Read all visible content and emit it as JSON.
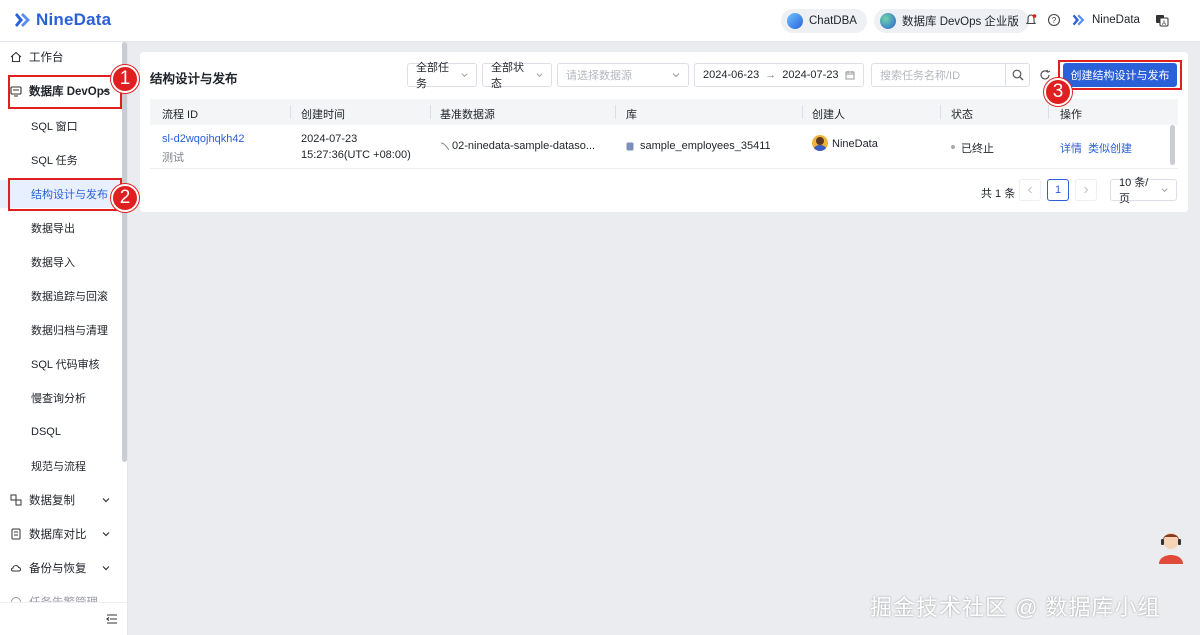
{
  "header": {
    "brand": "NineData",
    "chatdba": "ChatDBA",
    "edition": "数据库 DevOps 企业版",
    "user": "NineData"
  },
  "sidebar": {
    "workbench": "工作台",
    "devops": "数据库 DevOps",
    "sub_items": [
      "SQL 窗口",
      "SQL 任务",
      "结构设计与发布",
      "数据导出",
      "数据导入",
      "数据追踪与回滚",
      "数据归档与清理",
      "SQL 代码审核",
      "慢查询分析",
      "DSQL",
      "规范与流程"
    ],
    "groups": [
      "数据复制",
      "数据库对比",
      "备份与恢复",
      "任务告警管理"
    ]
  },
  "main": {
    "title": "结构设计与发布",
    "filter_task": "全部任务",
    "filter_status": "全部状态",
    "datasource_placeholder": "请选择数据源",
    "date_start": "2024-06-23",
    "date_arrow": "→",
    "date_end": "2024-07-23",
    "search_placeholder": "搜索任务名称/ID",
    "create_button": "创建结构设计与发布",
    "columns": [
      "流程 ID",
      "创建时间",
      "基准数据源",
      "库",
      "创建人",
      "状态",
      "操作"
    ],
    "row": {
      "id": "sl-d2wqojhqkh42",
      "note": "测试",
      "created_date": "2024-07-23",
      "created_time": "15:27:36(UTC +08:00)",
      "datasource": "02-ninedata-sample-dataso...",
      "database": "sample_employees_35411",
      "creator": "NineData",
      "status": "已终止",
      "action_detail": "详情",
      "action_clone": "类似创建"
    },
    "pagination": {
      "total": "共 1 条",
      "current_page": "1",
      "page_size": "10 条/页"
    }
  },
  "annotations": [
    "1",
    "2",
    "3"
  ],
  "watermark": "掘金技术社区 @ 数据库小组",
  "colors": {
    "primary": "#2b61d8",
    "annotation_red": "#e02020"
  }
}
